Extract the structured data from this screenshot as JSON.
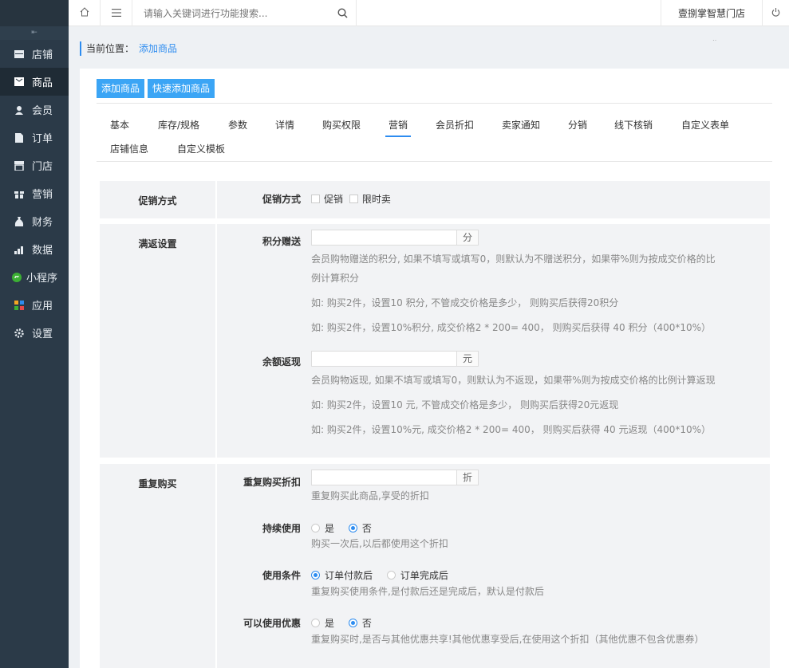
{
  "sidebar": {
    "collapse_glyph": "⇤",
    "items": [
      {
        "label": "店铺",
        "icon": "store-icon"
      },
      {
        "label": "商品",
        "icon": "goods-icon",
        "active": true
      },
      {
        "label": "会员",
        "icon": "member-icon"
      },
      {
        "label": "订单",
        "icon": "order-icon"
      },
      {
        "label": "门店",
        "icon": "shop-icon"
      },
      {
        "label": "营销",
        "icon": "gift-icon"
      },
      {
        "label": "财务",
        "icon": "money-bag-icon"
      },
      {
        "label": "数据",
        "icon": "chart-icon"
      },
      {
        "label": "小程序",
        "icon": "mini-program-icon"
      },
      {
        "label": "应用",
        "icon": "apps-icon"
      },
      {
        "label": "设置",
        "icon": "gear-icon"
      }
    ]
  },
  "topbar": {
    "search_placeholder": "请输入关键词进行功能搜索...",
    "store_name": "壹捌掌智慧门店"
  },
  "breadcrumb": {
    "prefix": "当前位置：",
    "current": "添加商品",
    "dots": "‥"
  },
  "actions": {
    "add": "添加商品",
    "quick_add": "快速添加商品"
  },
  "tabs": [
    "基本",
    "库存/规格",
    "参数",
    "详情",
    "购买权限",
    "营销",
    "会员折扣",
    "卖家通知",
    "分销",
    "线下核销",
    "自定义表单",
    "店铺信息",
    "自定义模板"
  ],
  "active_tab": "营销",
  "promo": {
    "section_title": "促销方式",
    "label": "促销方式",
    "options": [
      "促销",
      "限时卖"
    ]
  },
  "rebate": {
    "section_title": "满返设置",
    "points_label": "积分赠送",
    "points_unit": "分",
    "points_help": [
      "会员购物赠送的积分, 如果不填写或填写0，则默认为不赠送积分，如果带%则为按成交价格的比",
      "例计算积分",
      "如: 购买2件，设置10 积分, 不管成交价格是多少， 则购买后获得20积分",
      "如: 购买2件，设置10%积分, 成交价格2 * 200= 400， 则购买后获得 40 积分（400*10%）"
    ],
    "balance_label": "余额返现",
    "balance_unit": "元",
    "balance_help": [
      "会员购物返现, 如果不填写或填写0，则默认为不返现，如果带%则为按成交价格的比例计算返现",
      "如: 购买2件，设置10 元, 不管成交价格是多少， 则购买后获得20元返现",
      "如: 购买2件，设置10%元, 成交价格2 * 200= 400， 则购买后获得 40 元返现（400*10%）"
    ]
  },
  "repeat": {
    "section_title": "重复购买",
    "discount_label": "重复购买折扣",
    "discount_unit": "折",
    "discount_help": "重复购买此商品,享受的折扣",
    "continue_label": "持续使用",
    "continue_options": [
      "是",
      "否"
    ],
    "continue_selected": "否",
    "continue_help": "购买一次后,以后都使用这个折扣",
    "condition_label": "使用条件",
    "condition_options": [
      "订单付款后",
      "订单完成后"
    ],
    "condition_selected": "订单付款后",
    "condition_help": "重复购买使用条件,是付款后还是完成后，默认是付款后",
    "coupon_label": "可以使用优惠",
    "coupon_options": [
      "是",
      "否"
    ],
    "coupon_selected": "否",
    "coupon_help": "重复购买时,是否与其他优惠共享!其他优惠享受后,在使用这个折扣（其他优惠不包含优惠券）"
  }
}
